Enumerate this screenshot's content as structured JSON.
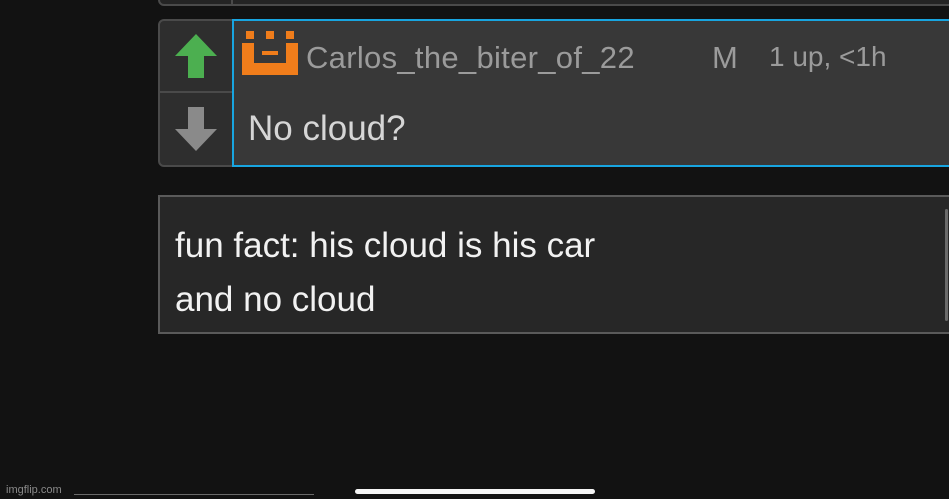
{
  "comment": {
    "username": "Carlos_the_biter_of_22",
    "badge": "M",
    "meta": "1 up, <1h",
    "text": "No cloud?",
    "avatar": "orange-pixel-crown-icon",
    "upvote_icon": "up-arrow-icon",
    "downvote_icon": "down-arrow-icon"
  },
  "reply": {
    "lines": [
      "fun fact: his cloud is his car",
      "and no cloud"
    ]
  },
  "watermark": "imgflip.com",
  "colors": {
    "background": "#121212",
    "upvote_active": "#4caf50",
    "downvote_inactive": "#8a8a8a",
    "avatar": "#f07d1b",
    "selected_border": "#18a5e0",
    "text_muted": "#9b9b9b"
  }
}
